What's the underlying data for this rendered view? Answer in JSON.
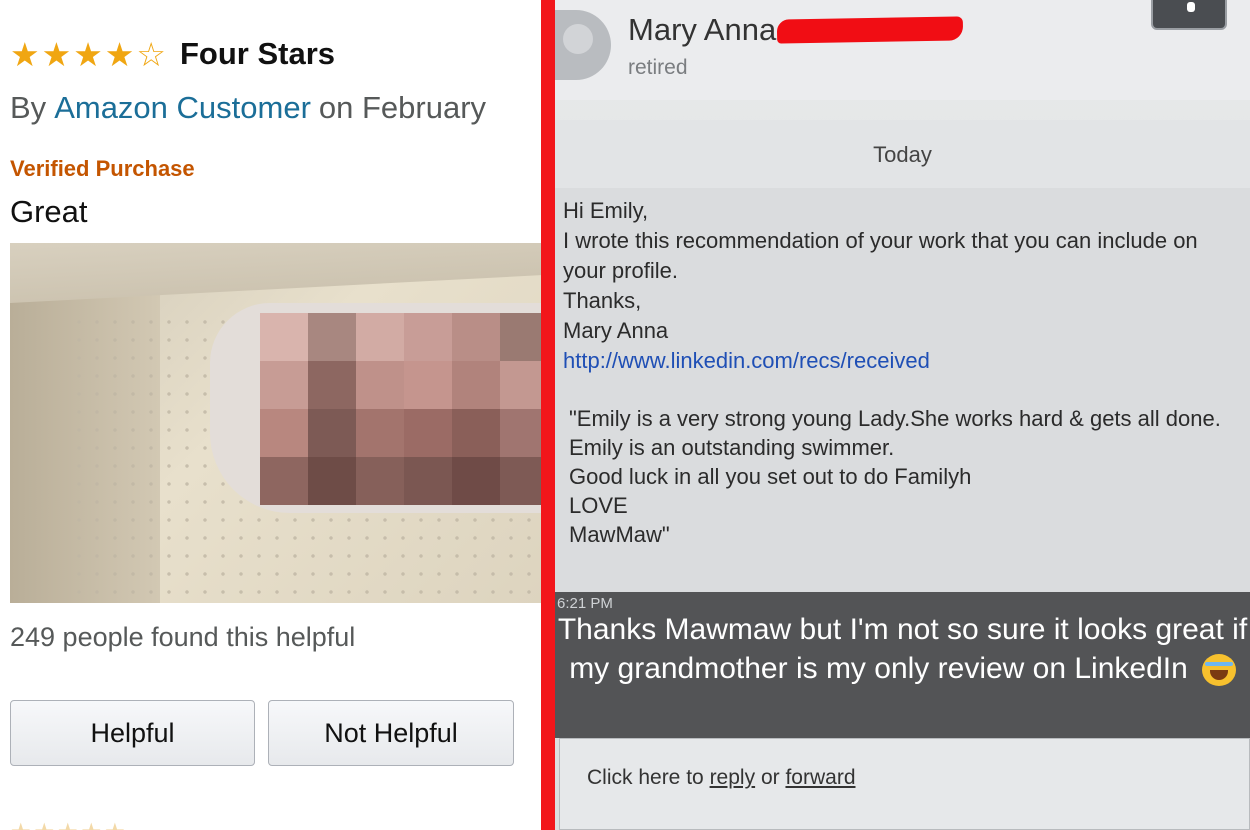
{
  "review": {
    "rating": 4,
    "rating_max": 5,
    "title_stars": "Four Stars",
    "by_prefix": "By",
    "author": "Amazon Customer",
    "date_prefix": "on February",
    "verified": "Verified Purchase",
    "review_title": "Great",
    "helpful_count": "249 people found this helpful",
    "helpful_button": "Helpful",
    "not_helpful_button": "Not Helpful"
  },
  "email": {
    "sender_name": "Mary Anna",
    "sender_title": "retired",
    "date_label": "Today",
    "greeting": "Hi Emily,",
    "body_line": "I wrote this recommendation of your work that you can include on your profile.",
    "thanks": "Thanks,",
    "signature": "Mary Anna",
    "link": "http://www.linkedin.com/recs/received",
    "quote_lines": [
      "\"Emily is a very strong young Lady.She works hard & gets all done.",
      "Emily is an outstanding swimmer.",
      "Good luck in all you set out to do Familyh",
      "LOVE",
      "MawMaw\""
    ],
    "time": "6:21 PM",
    "caption": "Thanks Mawmaw but I'm not so sure it looks great if my grandmother is my only review on LinkedIn",
    "reply_prefix": "Click here to",
    "reply_link": "reply",
    "reply_or": "or",
    "forward_link": "forward"
  },
  "colors": {
    "star": "#f0a612",
    "author_link": "#1b6e98",
    "verified": "#c45500",
    "divider": "#f2161b",
    "email_link": "#1f4fb5"
  },
  "icons": {
    "rating": "star-icon",
    "avatar": "person-avatar",
    "emoji": "tears-of-joy-emoji"
  }
}
